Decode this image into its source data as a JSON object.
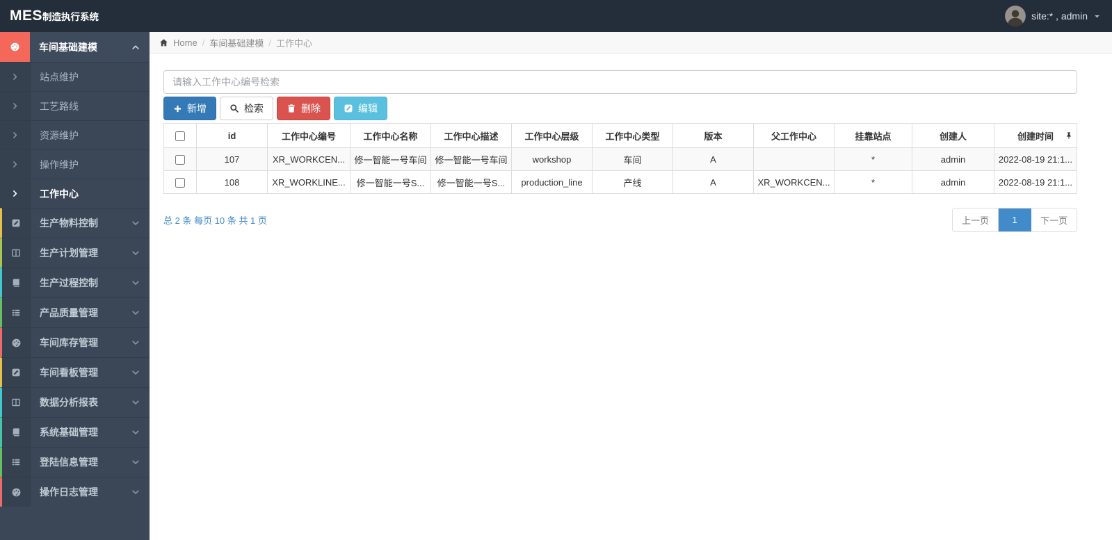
{
  "app": {
    "brand_bold": "MES",
    "brand_rest": "制造执行系统",
    "user": "site:* , admin"
  },
  "sidebar": {
    "active_group": {
      "label": "车间基础建模",
      "icon": "dashboard-icon",
      "accent": "#f4685c"
    },
    "submenu": [
      {
        "label": "站点维护",
        "active": false
      },
      {
        "label": "工艺路线",
        "active": false
      },
      {
        "label": "资源维护",
        "active": false
      },
      {
        "label": "操作维护",
        "active": false
      },
      {
        "label": "工作中心",
        "active": true
      }
    ],
    "groups": [
      {
        "label": "生产物料控制",
        "icon": "edit-icon",
        "accent": "#e7c04a"
      },
      {
        "label": "生产计划管理",
        "icon": "columns-icon",
        "accent": "#a8c455"
      },
      {
        "label": "生产过程控制",
        "icon": "book-icon",
        "accent": "#3fc8cd"
      },
      {
        "label": "产品质量管理",
        "icon": "list-icon",
        "accent": "#67bf63"
      },
      {
        "label": "车间库存管理",
        "icon": "dashboard-icon",
        "accent": "#ee6a68"
      },
      {
        "label": "车间看板管理",
        "icon": "edit-icon",
        "accent": "#e7c04a"
      },
      {
        "label": "数据分析报表",
        "icon": "columns-icon",
        "accent": "#3fc8cd"
      },
      {
        "label": "系统基础管理",
        "icon": "book-icon",
        "accent": "#45c5a5"
      },
      {
        "label": "登陆信息管理",
        "icon": "list-icon",
        "accent": "#67bf63"
      },
      {
        "label": "操作日志管理",
        "icon": "dashboard-icon",
        "accent": "#ee6a68"
      }
    ]
  },
  "breadcrumb": {
    "home": "Home",
    "crumbs": [
      "车间基础建模",
      "工作中心"
    ]
  },
  "search": {
    "placeholder": "请输入工作中心编号检索"
  },
  "toolbar": {
    "buttons": [
      {
        "name": "add-button",
        "label": "新增",
        "icon": "plus-icon",
        "style": "primary"
      },
      {
        "name": "search-button",
        "label": "检索",
        "icon": "search-icon",
        "style": "default"
      },
      {
        "name": "delete-button",
        "label": "删除",
        "icon": "trash-icon",
        "style": "danger"
      },
      {
        "name": "edit-button",
        "label": "编辑",
        "icon": "edit-icon",
        "style": "info"
      }
    ]
  },
  "table": {
    "columns": [
      "id",
      "工作中心编号",
      "工作中心名称",
      "工作中心描述",
      "工作中心层级",
      "工作中心类型",
      "版本",
      "父工作中心",
      "挂靠站点",
      "创建人",
      "创建时间"
    ],
    "rows": [
      {
        "cells": [
          "107",
          "XR_WORKCEN...",
          "修一智能一号车间",
          "修一智能一号车间",
          "workshop",
          "车间",
          "A",
          "",
          "*",
          "admin",
          "2022-08-19 21:1..."
        ]
      },
      {
        "cells": [
          "108",
          "XR_WORKLINE...",
          "修一智能一号S...",
          "修一智能一号S...",
          "production_line",
          "产线",
          "A",
          "XR_WORKCEN...",
          "*",
          "admin",
          "2022-08-19 21:1..."
        ]
      }
    ]
  },
  "pagination": {
    "summary": "总 2 条 每页 10 条 共 1 页",
    "prev": "上一页",
    "current": "1",
    "next": "下一页"
  },
  "icons": {
    "breadcrumb_home": "home-icon",
    "header_pin": "pin-icon",
    "user_caret": "caret-down-icon",
    "submenu_arrow": "chevron-right-icon",
    "group_collapsed": "chevron-down-icon",
    "group_expanded": "chevron-up-icon"
  },
  "colors": {
    "topbar": "#242d3a",
    "sidebar": "#3b4757",
    "active_icon": "#f4685c",
    "primary": "#337ab7",
    "info": "#5bc0de",
    "danger": "#d9534f",
    "link": "#428bca"
  }
}
